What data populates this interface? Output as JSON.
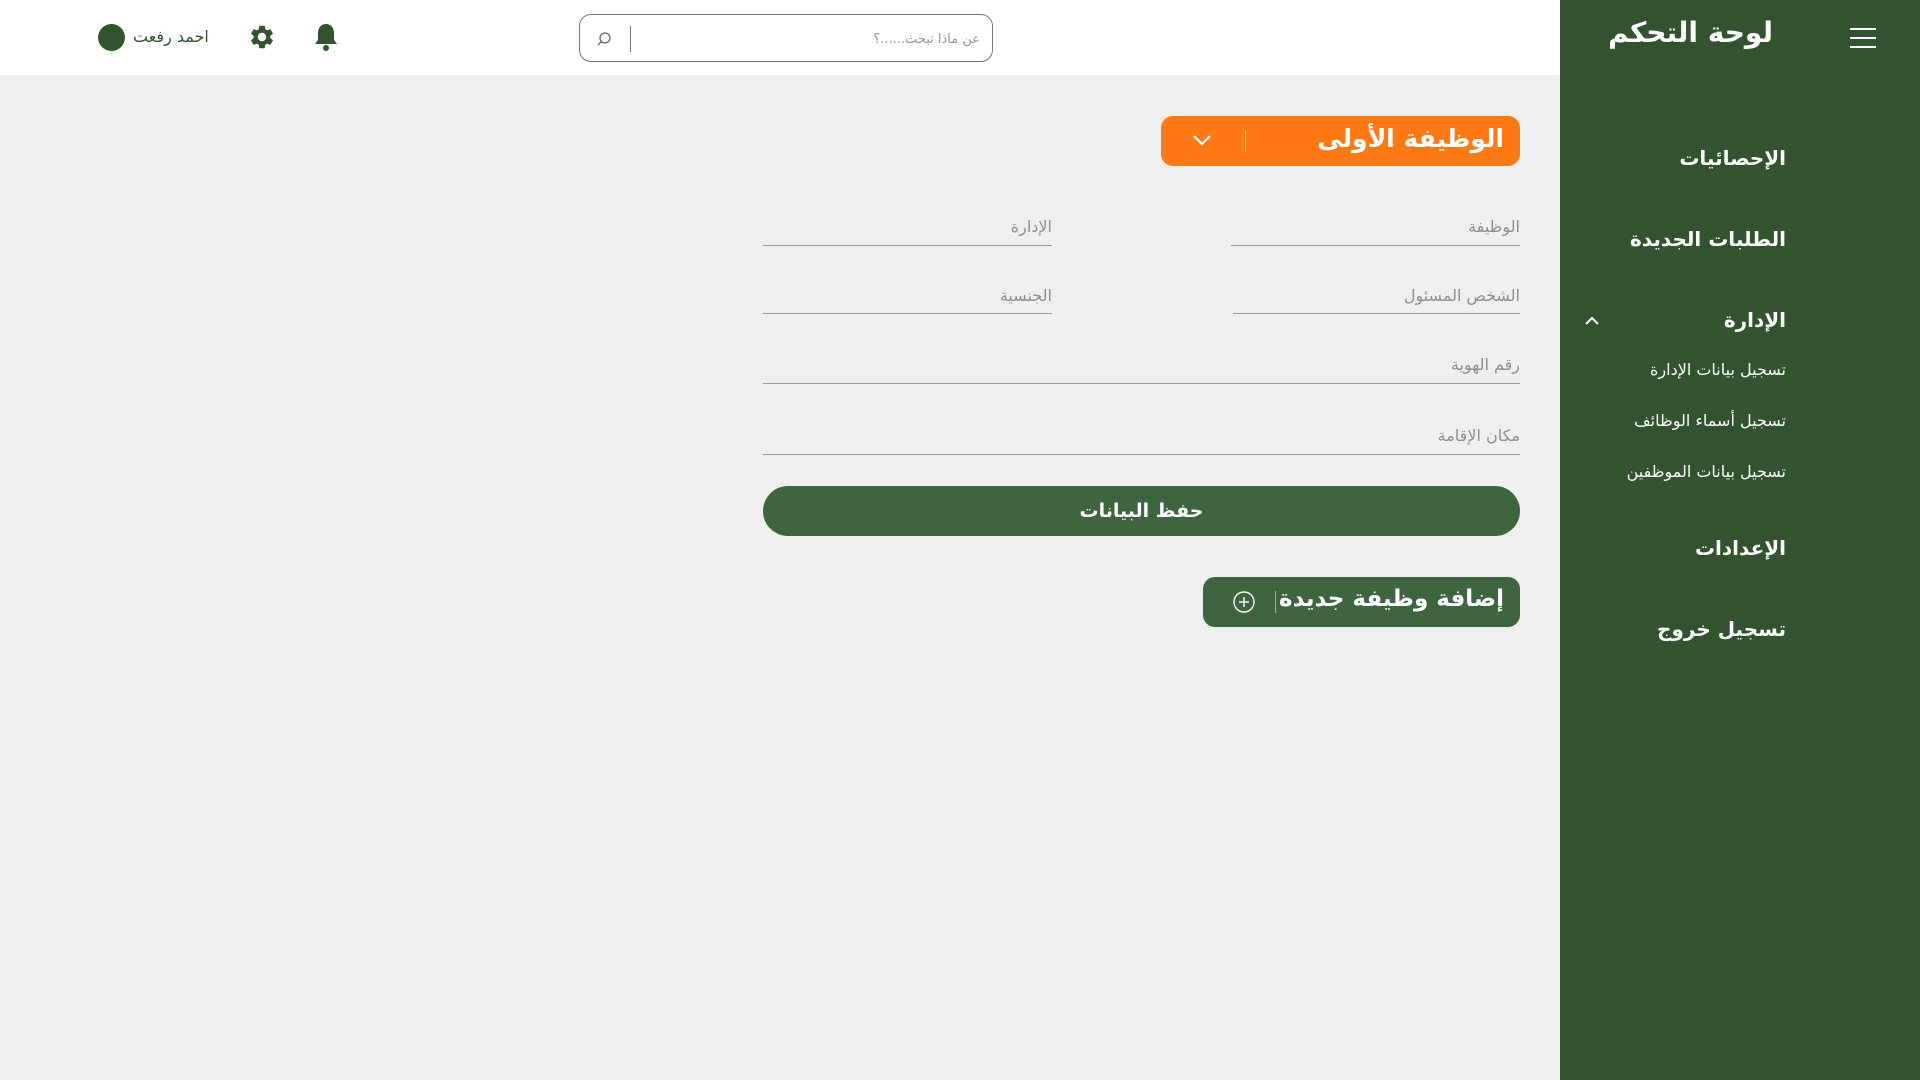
{
  "sidebar": {
    "title": "لوحة التحكم",
    "items": [
      {
        "label": "الإحصائيات"
      },
      {
        "label": "الطلبات الجديدة"
      },
      {
        "label": "الإدارة"
      },
      {
        "label": "الإعدادات"
      },
      {
        "label": "تسجيل خروج"
      }
    ],
    "submenu": [
      {
        "label": "تسجيل بيانات الإدارة"
      },
      {
        "label": "تسجيل أسماء الوظائف"
      },
      {
        "label": "تسجيل بيانات الموظفين"
      }
    ]
  },
  "topbar": {
    "search_placeholder": "عن ماذا تبحث......؟",
    "user_name": "احمد رفعت"
  },
  "job": {
    "title": "الوظيفة الأولى",
    "fields": {
      "job": "الوظيفة",
      "department": "الإدارة",
      "responsible": "الشخص المسئول",
      "nationality": "الجنسية",
      "id_number": "رقم الهوية",
      "residence": "مكان الإقامة"
    },
    "save_label": "حفظ البيانات"
  },
  "add_job_label": "إضافة وظيفة جديدة",
  "colors": {
    "sidebar": "#325230",
    "accent": "#ff7a14",
    "button": "#3e6440",
    "background": "#efefef"
  }
}
